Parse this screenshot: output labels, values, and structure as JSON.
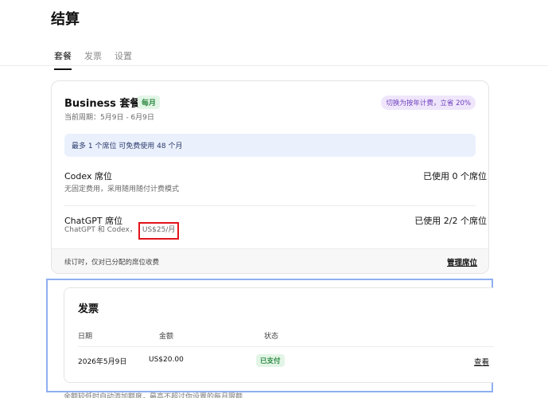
{
  "page": {
    "title": "结算"
  },
  "tabs": [
    {
      "label": "套餐",
      "active": true
    },
    {
      "label": "发票",
      "active": false
    },
    {
      "label": "设置",
      "active": false
    }
  ],
  "plan": {
    "title": "Business 套餐",
    "billing_badge": "每月",
    "promo_badge": "切换为按年计费，立省 20%",
    "period": "当前周期：5月9日 - 6月9日",
    "free_banner": "最多 1 个席位 可免费使用 48 个月",
    "seats": [
      {
        "name": "Codex 席位",
        "desc": "无固定费用，采用随用随付计费模式",
        "used": "已使用 0 个席位"
      },
      {
        "name": "ChatGPT 席位",
        "desc": "ChatGPT 和 Codex，",
        "price": "US$25/月",
        "used": "已使用 2/2 个席位"
      }
    ],
    "footer_note": "续订时，仅对已分配的席位收费",
    "manage_label": "管理席位"
  },
  "invoices": {
    "title": "发票",
    "headers": {
      "date": "日期",
      "amount": "金额",
      "status": "状态"
    },
    "rows": [
      {
        "date": "2026年5月9日",
        "amount": "US$20.00",
        "status": "已支付",
        "action": "查看"
      }
    ]
  },
  "bottom_partial_text": "余额较低时自动添加额度，最高不超过你设置的每月限额"
}
